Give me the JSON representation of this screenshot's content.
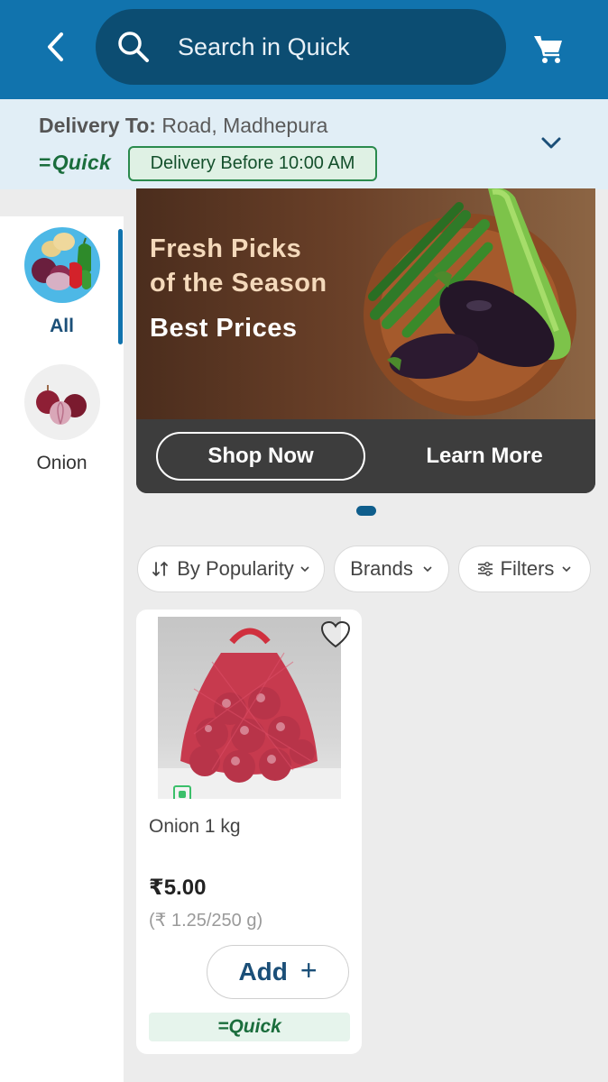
{
  "header": {
    "back_icon": "chevron-left-icon",
    "search_placeholder": "Search in Quick",
    "search_icon": "search-icon",
    "cart_icon": "cart-icon",
    "bg_color": "#1173ad"
  },
  "delivery": {
    "label": "Delivery To:",
    "location": "Road, Madhepura",
    "brand": "Quick",
    "badge": "Delivery Before 10:00 AM",
    "expand_icon": "chevron-down-icon"
  },
  "sidebar": {
    "items": [
      {
        "label": "All",
        "active": true
      },
      {
        "label": "Onion",
        "active": false
      }
    ]
  },
  "banner": {
    "headline_1": "Fresh Picks",
    "headline_2": "of the Season",
    "subheadline": "Best Prices",
    "shop_button": "Shop Now",
    "learn_button": "Learn More",
    "slide_count": 1,
    "active_slide": 1
  },
  "filters": {
    "sort_label": "By Popularity",
    "brands_label": "Brands",
    "filters_label": "Filters"
  },
  "products": [
    {
      "name": "Onion 1 kg",
      "price": "₹5.00",
      "unit_price": "(₹ 1.25/250 g)",
      "add_label": "Add",
      "brand": "Quick",
      "favorite": false
    }
  ]
}
